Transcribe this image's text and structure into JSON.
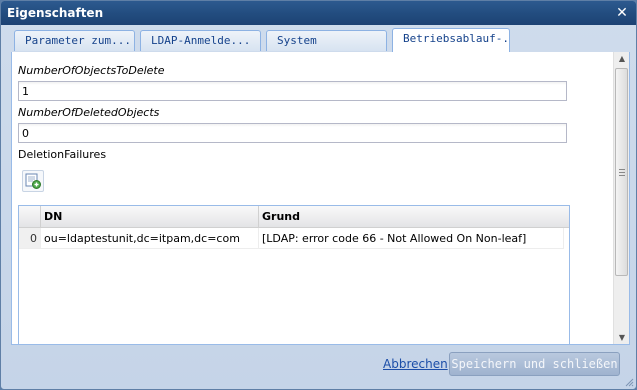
{
  "window": {
    "title": "Eigenschaften"
  },
  "tabs": [
    {
      "label": "Parameter zum..."
    },
    {
      "label": "LDAP-Anmelde..."
    },
    {
      "label": "System"
    },
    {
      "label": "Betriebsablauf-..."
    }
  ],
  "active_tab": 3,
  "fields": {
    "objects_to_delete": {
      "label": "NumberOfObjectsToDelete",
      "value": "1"
    },
    "deleted_objects": {
      "label": "NumberOfDeletedObjects",
      "value": "0"
    },
    "deletion_failures": {
      "label": "DeletionFailures"
    }
  },
  "grid": {
    "columns": [
      "DN",
      "Grund"
    ],
    "rows": [
      {
        "index": "0",
        "dn": "ou=ldaptestunit,dc=itpam,dc=com",
        "grund": "[LDAP: error code 66 - Not Allowed On Non-leaf]"
      }
    ]
  },
  "footer": {
    "cancel_label": "Abbrechen",
    "save_label": "Speichern und schließen"
  },
  "icons": {
    "close": "close-icon",
    "add_row": "add-row-icon"
  }
}
